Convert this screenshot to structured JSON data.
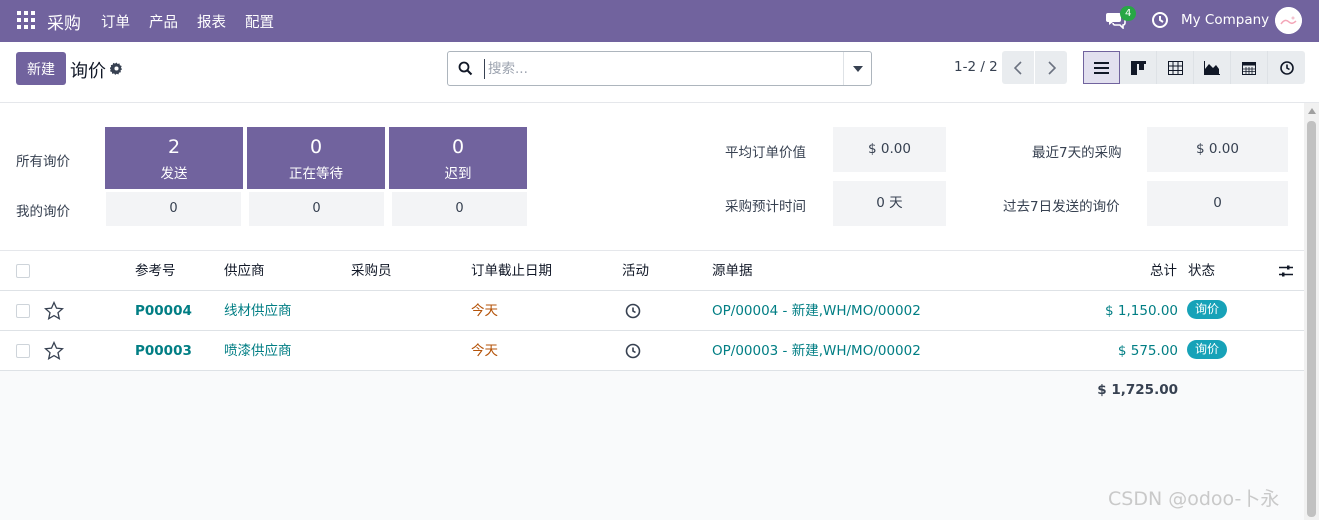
{
  "navbar": {
    "app": "采购",
    "menu": [
      "订单",
      "产品",
      "报表",
      "配置"
    ],
    "chat_count": "4",
    "company": "My Company"
  },
  "control": {
    "new_label": "新建",
    "title": "询价",
    "search_placeholder": "搜索...",
    "pager": "1-2 / 2"
  },
  "dashboard": {
    "all_label": "所有询价",
    "my_label": "我的询价",
    "tiles": [
      {
        "count": "2",
        "caption": "发送",
        "my": "0"
      },
      {
        "count": "0",
        "caption": "正在等待",
        "my": "0"
      },
      {
        "count": "0",
        "caption": "迟到",
        "my": "0"
      }
    ],
    "kpis": [
      {
        "label": "平均订单价值",
        "value": "$ 0.00"
      },
      {
        "label": "采购预计时间",
        "value": "0 天"
      },
      {
        "label": "最近7天的采购",
        "value": "$ 0.00"
      },
      {
        "label": "过去7日发送的询价",
        "value": "0"
      }
    ]
  },
  "table": {
    "headers": {
      "ref": "参考号",
      "vendor": "供应商",
      "buyer": "采购员",
      "deadline": "订单截止日期",
      "activity": "活动",
      "source": "源单据",
      "total": "总计",
      "status": "状态"
    },
    "rows": [
      {
        "ref": "P00004",
        "vendor": "线材供应商",
        "buyer": "",
        "deadline": "今天",
        "source": "OP/00004 - 新建,WH/MO/00002",
        "total": "$ 1,150.00",
        "status": "询价"
      },
      {
        "ref": "P00003",
        "vendor": "喷漆供应商",
        "buyer": "",
        "deadline": "今天",
        "source": "OP/00003 - 新建,WH/MO/00002",
        "total": "$ 575.00",
        "status": "询价"
      }
    ],
    "grand_total": "$ 1,725.00"
  },
  "watermark": "CSDN @odoo-卜永",
  "colors": {
    "brand": "#71639e",
    "link": "#017e84",
    "status": "#17a2b8",
    "deadline": "#b45309"
  }
}
